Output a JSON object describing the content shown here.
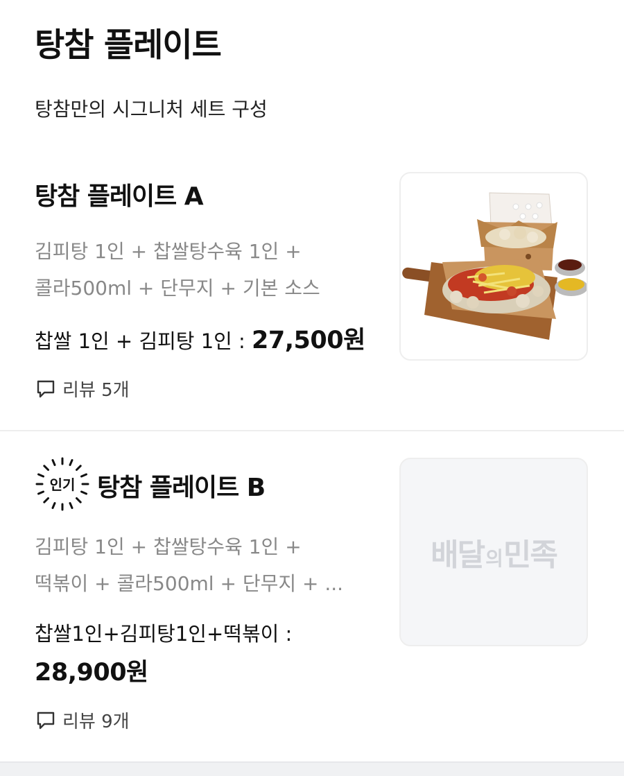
{
  "section": {
    "title": "탕참 플레이트",
    "description": "탕참만의 시그니처 세트 구성"
  },
  "items": [
    {
      "name": "탕참 플레이트 A",
      "desc_line1": "김피탕 1인 + 찹쌀탕수육 1인 +",
      "desc_line2": "콜라500ml + 단무지 + 기본 소스",
      "price_label": "찹쌀 1인 + 김피탕 1인 : ",
      "price": "27,500원",
      "review_label": "리뷰 5개",
      "image_icon": "food-photo"
    },
    {
      "badge": "인기",
      "name": "탕참 플레이트 B",
      "desc_line1": "김피탕 1인 + 찹쌀탕수육 1인 +",
      "desc_line2": "떡볶이 + 콜라500ml + 단무지 + ...",
      "price_label": "찹쌀1인+김피탕1인+떡볶이 : ",
      "price": "28,900원",
      "review_label": "리뷰 9개",
      "image_placeholder": {
        "part1": "배달",
        "part2": "의",
        "part3": "민족"
      }
    }
  ],
  "colors": {
    "text": "#111111",
    "muted": "#888888",
    "divider": "#eeeeee",
    "placeholder_bg": "#f5f6f8"
  }
}
